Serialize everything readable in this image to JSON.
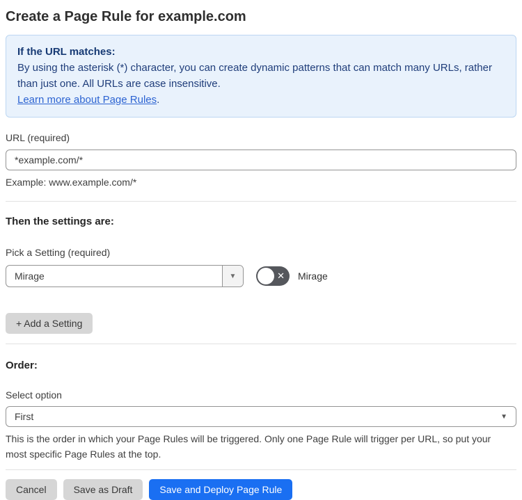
{
  "page": {
    "title": "Create a Page Rule for example.com"
  },
  "info_box": {
    "heading": "If the URL matches:",
    "body": "By using the asterisk (*) character, you can create dynamic patterns that can match many URLs, rather than just one. All URLs are case insensitive.",
    "link_label": "Learn more about Page Rules",
    "link_suffix": "."
  },
  "url_field": {
    "label": "URL (required)",
    "value": "*example.com/*",
    "helper": "Example: www.example.com/*"
  },
  "settings_section": {
    "heading": "Then the settings are:",
    "picker_label": "Pick a Setting (required)",
    "picker_value": "Mirage",
    "toggle_state": "off",
    "toggle_label": "Mirage",
    "add_setting_label": "+ Add a Setting"
  },
  "order_section": {
    "heading": "Order:",
    "select_label": "Select option",
    "select_value": "First",
    "helper": "This is the order in which your Page Rules will be triggered. Only one Page Rule will trigger per URL, so put your most specific Page Rules at the top."
  },
  "footer": {
    "cancel_label": "Cancel",
    "save_draft_label": "Save as Draft",
    "save_deploy_label": "Save and Deploy Page Rule"
  },
  "glyphs": {
    "caret_down": "▼",
    "toggle_x": "✕"
  },
  "colors": {
    "accent_blue": "#1a6ff2",
    "info_background": "#e9f2fc",
    "info_border": "#bcd6f2",
    "info_text": "#1f3d7a",
    "link_blue": "#2d64d2",
    "toggle_off_background": "#55575c",
    "gray_button": "#d6d6d6"
  }
}
